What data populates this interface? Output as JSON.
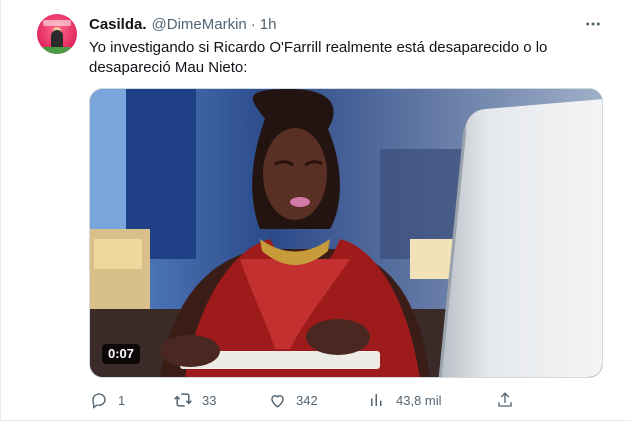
{
  "tweet": {
    "display_name": "Casilda.",
    "handle": "@DimeMarkin",
    "separator": "·",
    "time": "1h",
    "text": "Yo investigando si Ricardo O'Farrill realmente está desaparecido o lo desapareció Mau Nieto:",
    "media": {
      "type": "video",
      "duration": "0:07"
    }
  },
  "actions": {
    "reply": {
      "icon": "reply-icon",
      "count": "1"
    },
    "retweet": {
      "icon": "retweet-icon",
      "count": "33"
    },
    "like": {
      "icon": "heart-icon",
      "count": "342"
    },
    "views": {
      "icon": "views-icon",
      "count": "43,8 mil"
    },
    "share": {
      "icon": "share-icon"
    }
  },
  "colors": {
    "text_primary": "#0f1419",
    "text_secondary": "#536471",
    "border": "#cfd9de"
  }
}
